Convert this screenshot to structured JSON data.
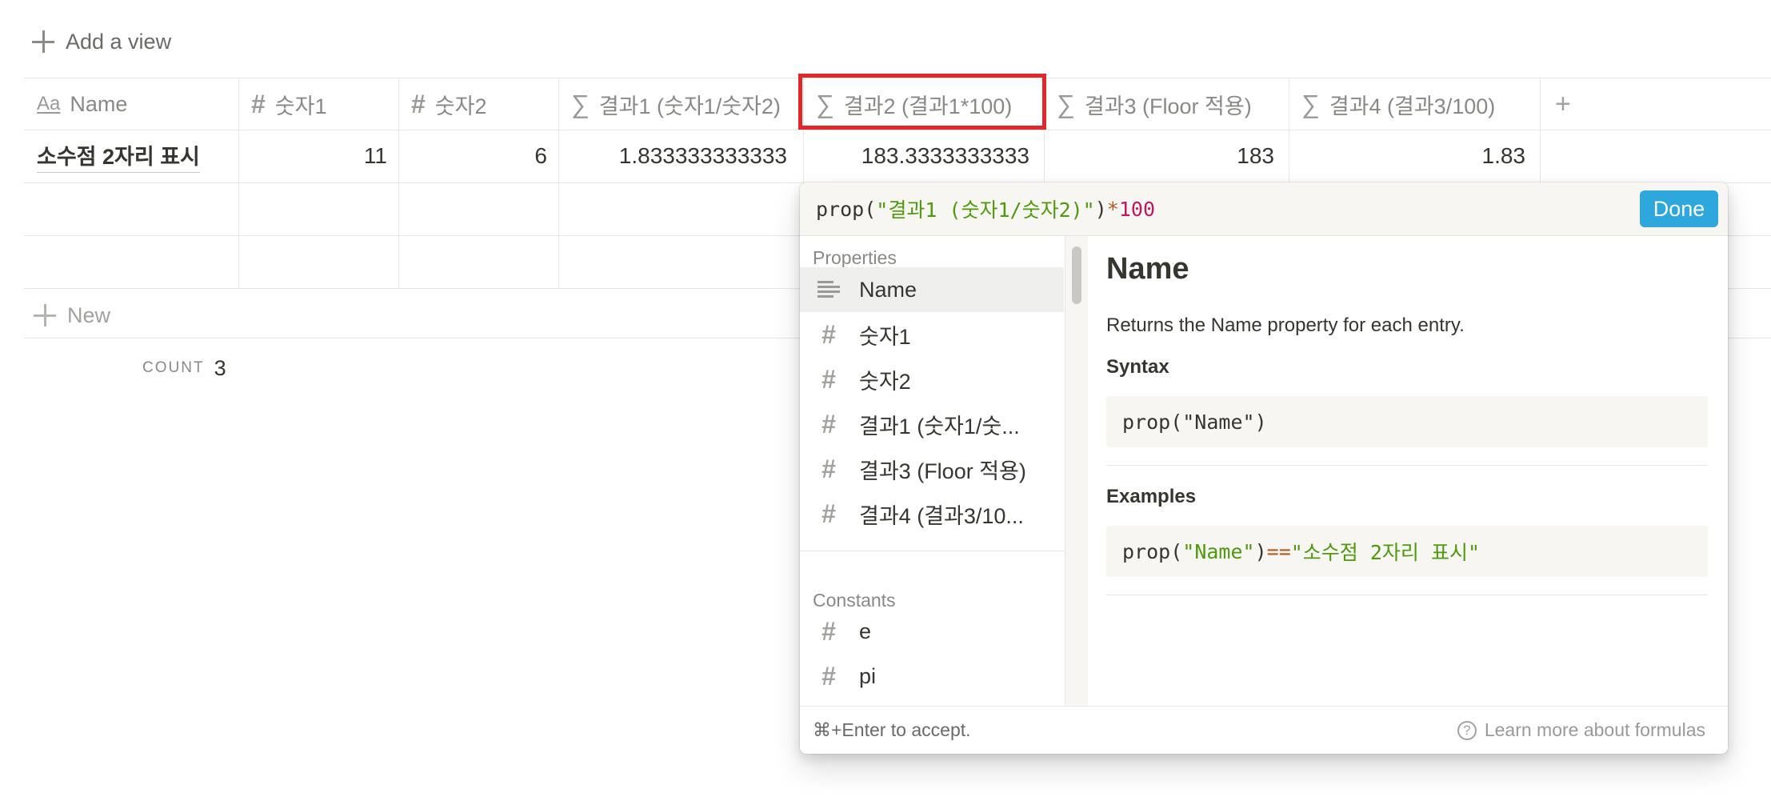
{
  "toolbar": {
    "add_view": "Add a view"
  },
  "table": {
    "columns": [
      {
        "icon": "text-aa-icon",
        "label": "Name"
      },
      {
        "icon": "hash-icon",
        "label": "숫자1"
      },
      {
        "icon": "hash-icon",
        "label": "숫자2"
      },
      {
        "icon": "sigma-icon",
        "label": "결과1 (숫자1/숫자2)"
      },
      {
        "icon": "sigma-icon",
        "label": "결과2 (결과1*100)"
      },
      {
        "icon": "sigma-icon",
        "label": "결과3 (Floor 적용)"
      },
      {
        "icon": "sigma-icon",
        "label": "결과4 (결과3/100)"
      }
    ],
    "add_column_icon": "plus-icon",
    "rows": [
      {
        "name": "소수점 2자리 표시",
        "n1": "11",
        "n2": "6",
        "r1": "1.833333333333",
        "r2": "183.3333333333",
        "r3": "183",
        "r4": "1.83"
      }
    ],
    "new_label": "New",
    "count_label": "COUNT",
    "count_value": "3"
  },
  "formula": {
    "fn": "prop(",
    "arg": "\"결과1 (숫자1/숫자2)\"",
    "close": ")",
    "op": "*",
    "num": "100",
    "done": "Done"
  },
  "properties": {
    "header": "Properties",
    "items": [
      {
        "icon": "text-lines-icon",
        "label": "Name",
        "selected": true
      },
      {
        "icon": "hash-icon",
        "label": "숫자1"
      },
      {
        "icon": "hash-icon",
        "label": "숫자2"
      },
      {
        "icon": "hash-icon",
        "label": "결과1 (숫자1/숫..."
      },
      {
        "icon": "hash-icon",
        "label": "결과3 (Floor 적용)"
      },
      {
        "icon": "hash-icon",
        "label": "결과4 (결과3/10..."
      }
    ]
  },
  "constants": {
    "header": "Constants",
    "items": [
      {
        "icon": "hash-icon",
        "label": "e"
      },
      {
        "icon": "hash-icon",
        "label": "pi"
      }
    ]
  },
  "docs": {
    "title": "Name",
    "description": "Returns the Name property for each entry.",
    "syntax_header": "Syntax",
    "syntax_code": "prop(\"Name\")",
    "examples_header": "Examples",
    "example_fn": "prop(",
    "example_arg": "\"Name\"",
    "example_close": ")",
    "example_op": "==",
    "example_value": "\"소수점 2자리 표시\""
  },
  "footer": {
    "hint": "⌘+Enter to accept.",
    "learn_more": "Learn more about formulas"
  },
  "colors": {
    "accent": "#2ea8dc",
    "highlight": "#e3262a",
    "string": "#4d9a0b",
    "operator": "#b35a1f",
    "number": "#c2185b"
  }
}
